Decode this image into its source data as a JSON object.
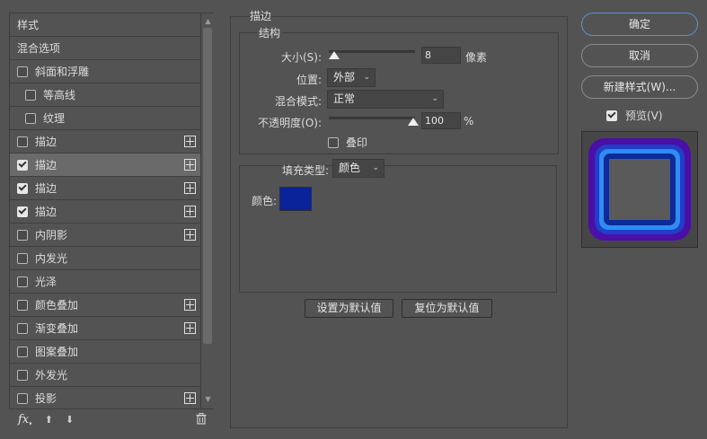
{
  "left_panel": {
    "items": [
      {
        "label": "样式",
        "type": "header"
      },
      {
        "label": "混合选项",
        "type": "header"
      },
      {
        "label": "斜面和浮雕",
        "checked": false,
        "indent": 0,
        "plus": false
      },
      {
        "label": "等高线",
        "checked": false,
        "indent": 1,
        "plus": false
      },
      {
        "label": "纹理",
        "checked": false,
        "indent": 1,
        "plus": false
      },
      {
        "label": "描边",
        "checked": false,
        "indent": 0,
        "plus": true
      },
      {
        "label": "描边",
        "checked": true,
        "indent": 0,
        "plus": true,
        "selected": true
      },
      {
        "label": "描边",
        "checked": true,
        "indent": 0,
        "plus": true
      },
      {
        "label": "描边",
        "checked": true,
        "indent": 0,
        "plus": true
      },
      {
        "label": "内阴影",
        "checked": false,
        "indent": 0,
        "plus": true
      },
      {
        "label": "内发光",
        "checked": false,
        "indent": 0,
        "plus": false
      },
      {
        "label": "光泽",
        "checked": false,
        "indent": 0,
        "plus": false
      },
      {
        "label": "颜色叠加",
        "checked": false,
        "indent": 0,
        "plus": true
      },
      {
        "label": "渐变叠加",
        "checked": false,
        "indent": 0,
        "plus": true
      },
      {
        "label": "图案叠加",
        "checked": false,
        "indent": 0,
        "plus": false
      },
      {
        "label": "外发光",
        "checked": false,
        "indent": 0,
        "plus": false
      },
      {
        "label": "投影",
        "checked": false,
        "indent": 0,
        "plus": true
      }
    ],
    "footer": {
      "fx_label": "fx"
    }
  },
  "stroke": {
    "title": "描边",
    "structure_title": "结构",
    "size_label": "大小(S):",
    "size_value": "8",
    "size_unit": "像素",
    "size_fraction": 0.0,
    "position_label": "位置:",
    "position_value": "外部",
    "blend_label": "混合模式:",
    "blend_value": "正常",
    "opacity_label": "不透明度(O):",
    "opacity_value": "100",
    "opacity_unit": "%",
    "opacity_fraction": 1.0,
    "overprint_label": "叠印",
    "overprint_checked": false,
    "fill_type_label": "填充类型:",
    "fill_type_value": "颜色",
    "color_label": "颜色:",
    "color_value": "#0a229a",
    "set_default_label": "设置为默认值",
    "reset_default_label": "复位为默认值"
  },
  "right_panel": {
    "ok_label": "确定",
    "cancel_label": "取消",
    "new_style_label": "新建样式(W)...",
    "preview_label": "预览(V)",
    "preview_checked": true,
    "preview_colors": {
      "outer": "#4b0ea6",
      "ring1": "#1f3fc8",
      "ring2": "#2f8cf0",
      "ring3": "#0d2a9a",
      "inner": "#5a5a5a"
    }
  }
}
